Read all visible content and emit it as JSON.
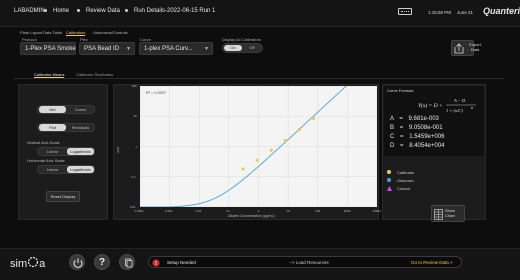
{
  "topbar": {
    "nav": [
      "LABADMIN",
      "Home",
      "Review Data",
      "Run Details-2022-06-15 Run 1"
    ],
    "time": "1:15:56 PM",
    "date": "June 21",
    "brand": "Quanterix"
  },
  "subtabs": [
    "Plate Layout",
    "Data Table",
    "Calibrators",
    "Unknowns/Controls"
  ],
  "fields": {
    "protocol_label": "Protocol",
    "protocol_value": "1-Plex PSA Smoke",
    "plex_label": "Plex",
    "plex_value": "PSA Bead ID",
    "curve_label": "Curve",
    "curve_value": "1-plex PSA Curv...",
    "display_label": "Display All Calibrators",
    "toggle_on": "On",
    "toggle_off": "Off"
  },
  "export": {
    "line1": "Export",
    "line2": "Data"
  },
  "lowtabs": [
    "Calibrator Means",
    "Calibrator Replicates"
  ],
  "left_panel": {
    "toggle1": [
      "Net",
      "Cones"
    ],
    "toggle2": [
      "Plot",
      "Residuals"
    ],
    "vertical_label": "Vertical Axis Scale",
    "horizontal_label": "Horizontal Axis Scale",
    "scale_opts": [
      "Linear",
      "Logarithmic"
    ],
    "reset": "Reset Display"
  },
  "chart_data": {
    "type": "line",
    "annotation": "R² = 0.9937",
    "xlabel": "Diluted Concentration (pg/mL)",
    "ylabel": "AEB",
    "x_ticks": [
      "0.0001",
      "0.001",
      "0.01",
      "0.1",
      "1",
      "10",
      "100",
      "1000",
      "10000"
    ],
    "y_ticks": [
      "100",
      "10",
      "1",
      "0.1",
      "0.01"
    ],
    "xscale": "log",
    "yscale": "log",
    "xlim": [
      0.0001,
      10000
    ],
    "ylim": [
      0.01,
      100
    ],
    "points": [
      {
        "x": 0.3,
        "y": 0.18
      },
      {
        "x": 0.9,
        "y": 0.35
      },
      {
        "x": 2.7,
        "y": 0.75
      },
      {
        "x": 8,
        "y": 1.6
      },
      {
        "x": 24,
        "y": 3.6
      },
      {
        "x": 72,
        "y": 8.5
      }
    ],
    "colors": {
      "curve": "#4aa3df",
      "calibrator": "#f2c94c"
    }
  },
  "formula": {
    "title": "Curve Formula",
    "expression": "Y(x) = D + (A − D) / (1 + (x/C)^B)",
    "coefficients": [
      {
        "name": "A",
        "value": "9.681e-003"
      },
      {
        "name": "B",
        "value": "9.0508e-001"
      },
      {
        "name": "C",
        "value": "1.5459e+006"
      },
      {
        "name": "D",
        "value": "8.4054e+004"
      }
    ]
  },
  "legend": [
    {
      "label": "Calibrator",
      "color": "#f2c94c"
    },
    {
      "label": "Unknown",
      "color": "#4aa3df"
    },
    {
      "label": "Control",
      "color": "#c94cf2"
    }
  ],
  "show_chart": {
    "line1": "Show",
    "line2": "Chart"
  },
  "bottom": {
    "logo": "sim",
    "logo_end": "a",
    "setup": "Setup Needed",
    "load": "--> Load Resources",
    "review": "Go to Review Data >"
  }
}
